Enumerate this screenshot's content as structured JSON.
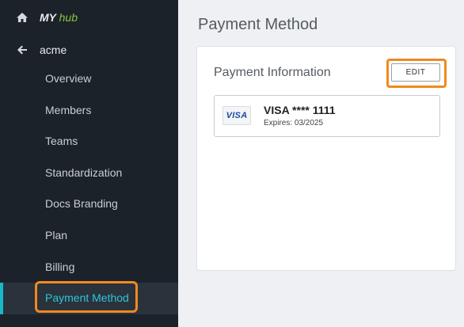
{
  "sidebar": {
    "brand": {
      "prefix": "MY",
      "suffix": "hub"
    },
    "org_name": "acme",
    "items": [
      {
        "label": "Overview"
      },
      {
        "label": "Members"
      },
      {
        "label": "Teams"
      },
      {
        "label": "Standardization"
      },
      {
        "label": "Docs Branding"
      },
      {
        "label": "Plan"
      },
      {
        "label": "Billing"
      },
      {
        "label": "Payment Method",
        "active": true
      }
    ],
    "accent_color": "#18b8c8",
    "brand_accent_color": "#8cc63f"
  },
  "main": {
    "title": "Payment Method",
    "card": {
      "title": "Payment Information",
      "edit_label": "EDIT",
      "payment_method": {
        "brand": "VISA",
        "number": "VISA **** 1111",
        "expires": "Expires: 03/2025"
      }
    }
  },
  "icons": {
    "home": "home-icon",
    "back": "arrow-left-icon",
    "card_brand": "visa-logo"
  },
  "highlight_color": "#f08a1d"
}
